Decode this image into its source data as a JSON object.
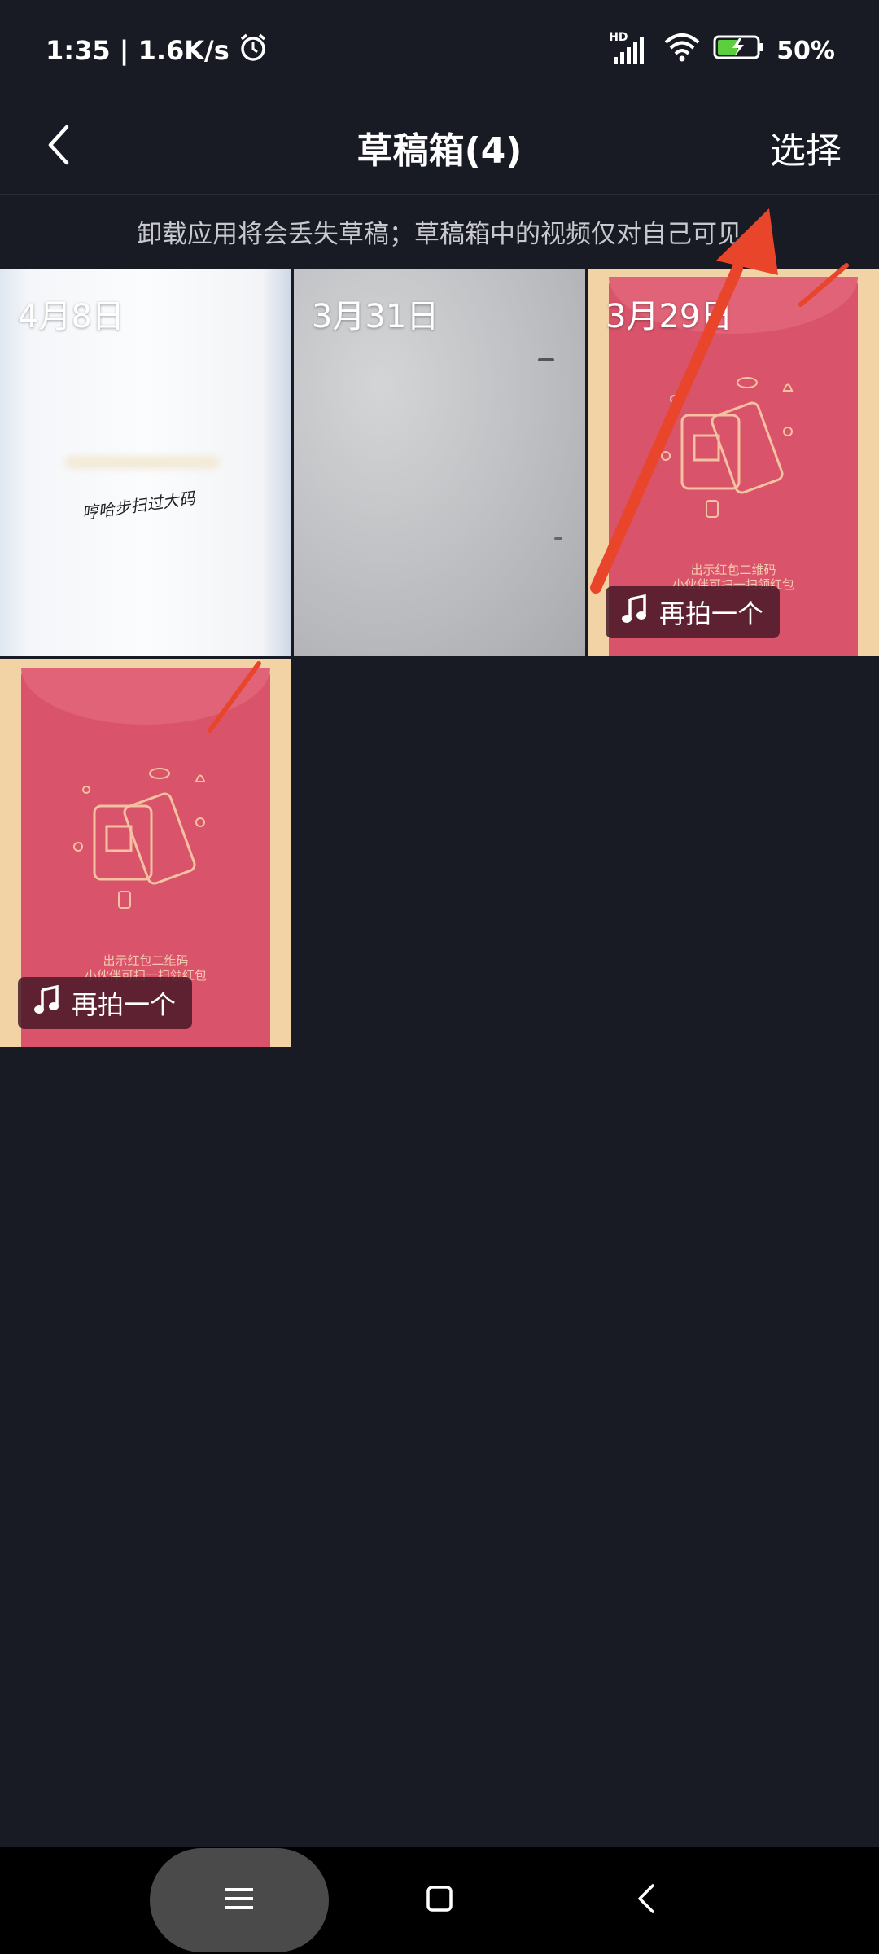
{
  "status": {
    "time_speed": "1:35 | 1.6K/s",
    "network": "HD",
    "battery": "50%"
  },
  "header": {
    "title": "草稿箱(4)",
    "select_label": "选择"
  },
  "notice": "卸载应用将会丢失草稿；草稿箱中的视频仅对自己可见",
  "drafts": [
    {
      "date": "4月8日",
      "overlay_text": "哼哈步扫过大码"
    },
    {
      "date": "3月31日"
    },
    {
      "date": "3月29日",
      "reshoot_label": "再拍一个",
      "caption_line1": "出示红包二维码",
      "caption_line2": "小伙伴可扫一扫领红包"
    },
    {
      "reshoot_label": "再拍一个",
      "caption_line1": "出示红包二维码",
      "caption_line2": "小伙伴可扫一扫领红包"
    }
  ],
  "colors": {
    "background": "#181a24",
    "envelope": "#d9536a",
    "annotation_arrow": "#e8452b"
  },
  "icons": {
    "back": "chevron-left-icon",
    "music": "music-note-icon",
    "menu": "hamburger-menu-icon",
    "home": "square-home-icon",
    "nav_back": "triangle-back-icon"
  }
}
